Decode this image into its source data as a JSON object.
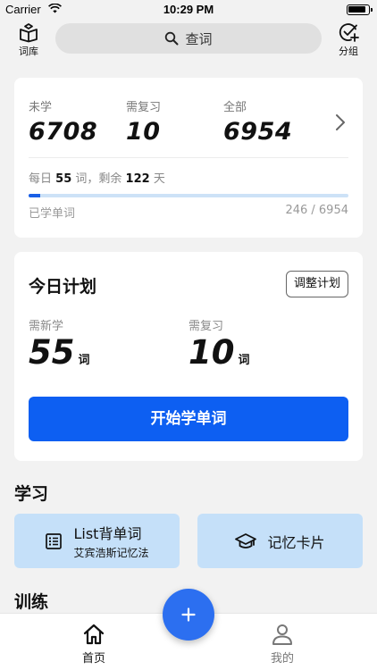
{
  "status_bar": {
    "carrier": "Carrier",
    "time": "10:29 PM"
  },
  "nav": {
    "left_label": "词库",
    "left_icon": "book-icon",
    "right_label": "分组",
    "right_icon": "check-plus-icon",
    "search_placeholder": "查词",
    "search_icon": "search-icon"
  },
  "stats": {
    "unlearned_label": "未学",
    "unlearned_value": "6708",
    "review_label": "需复习",
    "review_value": "10",
    "total_label": "全部",
    "total_value": "6954",
    "daily_prefix": "每日",
    "daily_count": "55",
    "daily_mid": "词，剩余",
    "days_left": "122",
    "daily_suffix": "天",
    "progress_fraction": 0.0354,
    "learned_label": "已学单词",
    "learned_ratio": "246 / 6954"
  },
  "plan": {
    "title": "今日计划",
    "adjust_label": "调整计划",
    "new_label": "需新学",
    "new_value": "55",
    "new_unit": "词",
    "review_label": "需复习",
    "review_value": "10",
    "review_unit": "词",
    "start_label": "开始学单词"
  },
  "study": {
    "section_title": "学习",
    "list_title": "List背单词",
    "list_subtitle": "艾宾浩斯记忆法",
    "list_icon": "list-icon",
    "cards_title": "记忆卡片",
    "cards_icon": "graduation-cap-icon"
  },
  "training": {
    "section_title": "训练"
  },
  "tabs": {
    "home_label": "首页",
    "home_icon": "home-icon",
    "mine_label": "我的",
    "mine_icon": "person-icon",
    "fab_icon": "plus-icon"
  },
  "colors": {
    "primary": "#0d5ff2",
    "fab": "#2c6ff0",
    "feature_bg": "#c5e0f9",
    "progress_track": "#cde2f7"
  }
}
